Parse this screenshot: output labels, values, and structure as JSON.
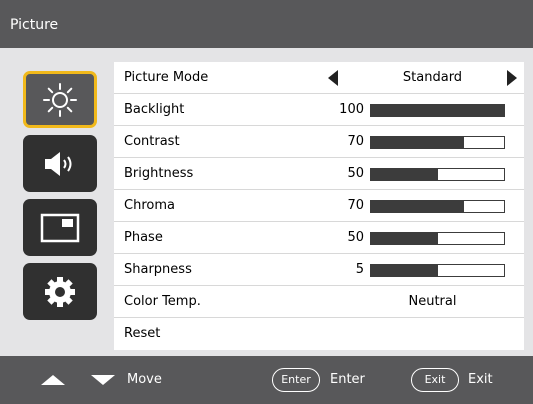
{
  "title": "Picture",
  "tabs": [
    {
      "icon": "sun-icon",
      "active": true
    },
    {
      "icon": "speaker-icon",
      "active": false
    },
    {
      "icon": "screen-icon",
      "active": false
    },
    {
      "icon": "gear-icon",
      "active": false
    }
  ],
  "settings": {
    "picture_mode": {
      "label": "Picture Mode",
      "value": "Standard"
    },
    "backlight": {
      "label": "Backlight",
      "value": "100",
      "level": 100
    },
    "contrast": {
      "label": "Contrast",
      "value": "70",
      "level": 70
    },
    "brightness": {
      "label": "Brightness",
      "value": "50",
      "level": 50
    },
    "chroma": {
      "label": "Chroma",
      "value": "70",
      "level": 70
    },
    "phase": {
      "label": "Phase",
      "value": "50",
      "level": 50
    },
    "sharpness": {
      "label": "Sharpness",
      "value": "5",
      "level": 50
    },
    "color_temp": {
      "label": "Color Temp.",
      "value": "Neutral"
    },
    "reset": {
      "label": "Reset"
    }
  },
  "footer": {
    "move_label": "Move",
    "enter_key": "Enter",
    "enter_label": "Enter",
    "exit_key": "Exit",
    "exit_label": "Exit"
  },
  "colors": {
    "accent": "#f1b91b",
    "bar_fill": "#3c3c3c",
    "header": "#58585a"
  }
}
